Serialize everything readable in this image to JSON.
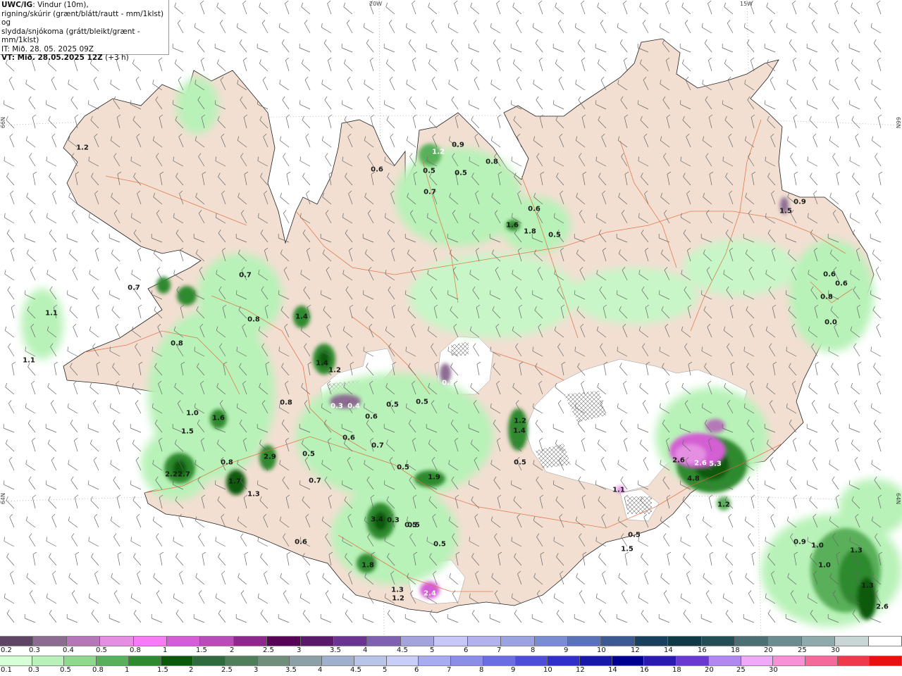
{
  "header": {
    "source": "UWC/IG",
    "desc_line1": ": Vindur (10m),",
    "desc_line2": "rigning/skúrir (grænt/blátt/rautt - mm/1klst) og",
    "desc_line3": "slydda/snjókoma (grátt/bleikt/grænt - mm/1klst)",
    "it_line": "IT: Mið. 28. 05. 2025 09Z",
    "vt_label": "VT: Mið. 28.05.2025 12Z",
    "vt_suffix": " (+3 h)"
  },
  "grid_labels": {
    "lon_20w": "20W",
    "lon_15w": "15W",
    "lat_66n_left": "66N",
    "lat_66n_right": "66N",
    "lat_64n_left": "64N",
    "lat_64n_right": "64N"
  },
  "precip_labels": [
    "1.2",
    "0.6",
    "1.2",
    "0.9",
    "0.5",
    "0.5",
    "0.8",
    "0.7",
    "0.6",
    "1.6",
    "1.8",
    "0.5",
    "0.9",
    "1.5",
    "0.7",
    "1.1",
    "1.1",
    "0.7",
    "0.8",
    "1.4",
    "0.8",
    "0.6",
    "0.6",
    "0.8",
    "0.0",
    "1.4",
    "1.2",
    "0.3",
    "0.8",
    "0.3",
    "0.4",
    "0.5",
    "0.5",
    "0.6",
    "1.0",
    "1.6",
    "1.5",
    "0.6",
    "0.5",
    "0.7",
    "1.2",
    "1.4",
    "0.5",
    "0.5",
    "2.2",
    "2.7",
    "0.8",
    "2.9",
    "0.7",
    "0.5",
    "1.9",
    "2.6",
    "2.6",
    "5.3",
    "4.8",
    "1.7",
    "1.3",
    "1.1",
    "3.4",
    "0.3",
    "0.5",
    "1.2",
    "0.6",
    "0.5",
    "0.5",
    "0.9",
    "1.0",
    "1.3",
    "1.0",
    "1.8",
    "1.5",
    "1.2",
    "1.3",
    "2.4",
    "1.3",
    "2.6"
  ],
  "legend": {
    "snow_colors": [
      "#5e4565",
      "#8c6c91",
      "#b677b9",
      "#e58fe3",
      "#f77cf4",
      "#d45fd4",
      "#b84cb8",
      "#8d298d",
      "#560456",
      "#5a1a6a",
      "#6b3491",
      "#8060b0",
      "#a4a4dc",
      "#c8c8f8",
      "#b2b2ec",
      "#9ba3e0",
      "#7a8cd2",
      "#5a72b8",
      "#3c5a92",
      "#18405c",
      "#103a45",
      "#244e56",
      "#4c6f74",
      "#6b8d90",
      "#8eaaaa",
      "#c8d6d6",
      "#ffffff"
    ],
    "snow_ticks": [
      "0.2",
      "0.3",
      "0.4",
      "0.5",
      "0.8",
      "1",
      "1.5",
      "2",
      "2.5",
      "3",
      "3.5",
      "4",
      "4.5",
      "5",
      "6",
      "7",
      "8",
      "9",
      "10",
      "12",
      "14",
      "16",
      "18",
      "20",
      "25",
      "30"
    ],
    "rain_colors": [
      "#d6ffd6",
      "#b8f2b8",
      "#8ed98e",
      "#5ab05a",
      "#2f8a2f",
      "#0b5a0b",
      "#2f6a3f",
      "#4f7f5a",
      "#6f8f7a",
      "#8ca0a8",
      "#9fb0cc",
      "#b8c4e8",
      "#c8cef8",
      "#a7acf0",
      "#8a8ee6",
      "#6b6ee0",
      "#4c4ed8",
      "#3030c8",
      "#1818a8",
      "#000090",
      "#2a1ab0",
      "#6a3ad0",
      "#b088f0",
      "#f0a8f8",
      "#f890d8",
      "#f46a9a",
      "#f03a4a",
      "#e81010"
    ],
    "rain_ticks": [
      "0.1",
      "0.3",
      "0.5",
      "0.8",
      "1",
      "1.5",
      "2",
      "2.5",
      "3",
      "3.5",
      "4",
      "4.5",
      "5",
      "6",
      "7",
      "8",
      "9",
      "10",
      "12",
      "14",
      "16",
      "18",
      "20",
      "25",
      "30"
    ]
  }
}
